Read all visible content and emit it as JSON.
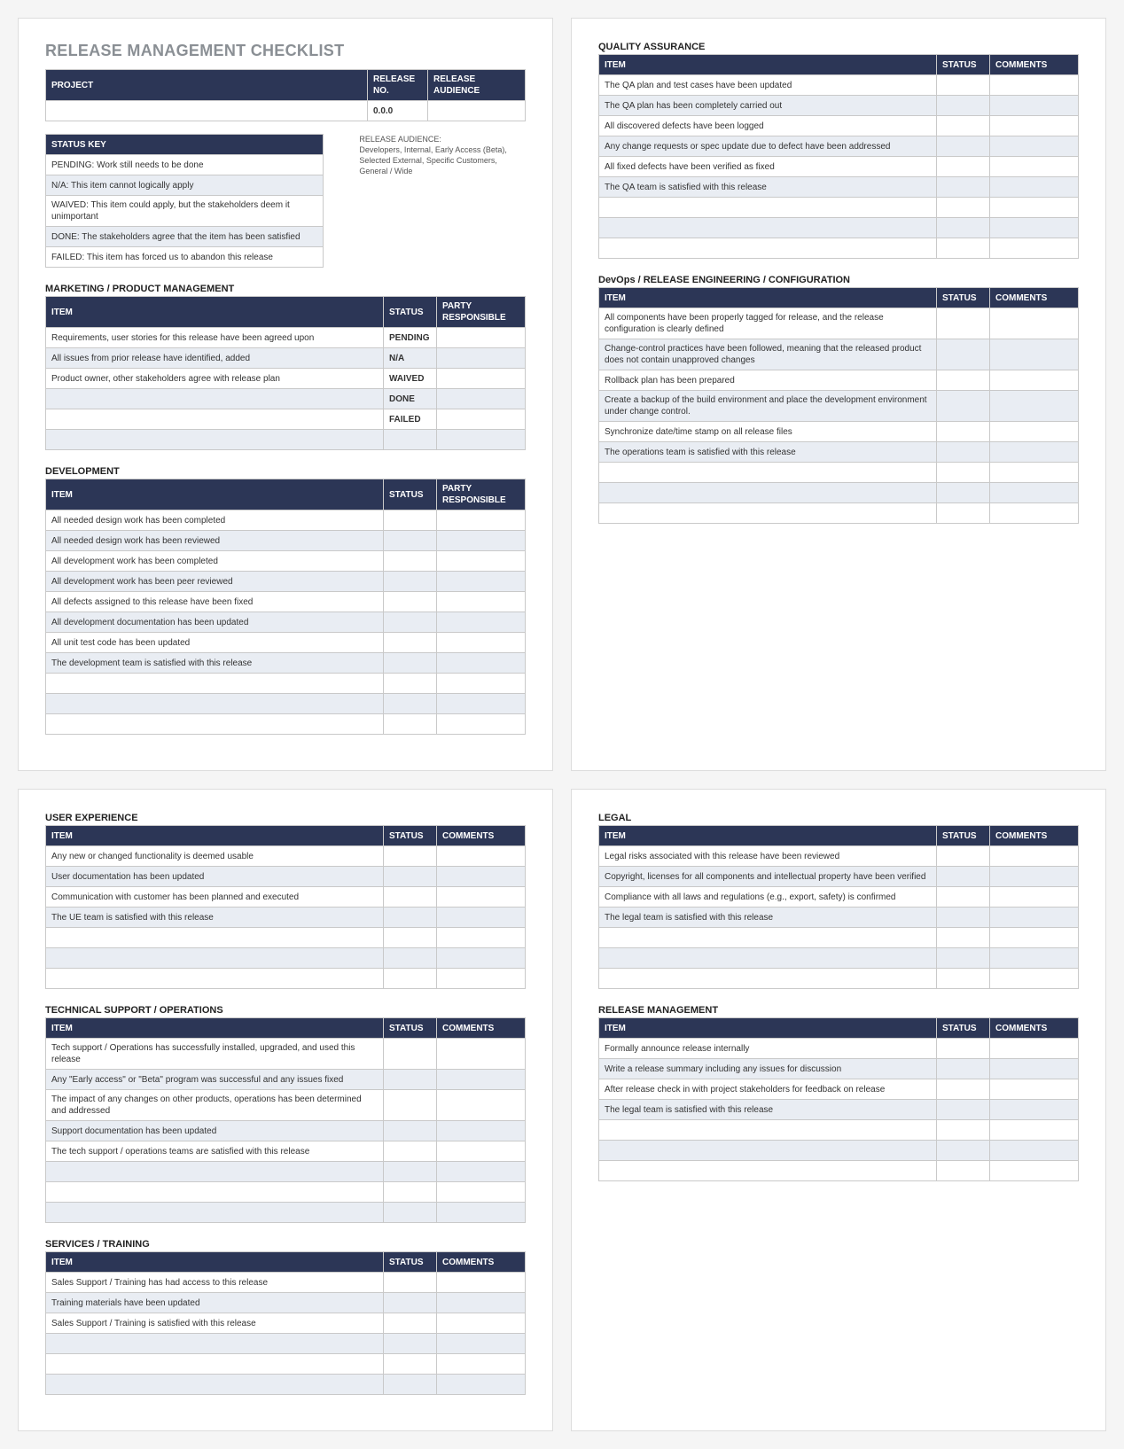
{
  "title": "RELEASE MANAGEMENT CHECKLIST",
  "proj_header": {
    "project": "PROJECT",
    "release_no": "RELEASE NO.",
    "release_aud": "RELEASE AUDIENCE",
    "release_no_val": "0.0.0"
  },
  "status_key": {
    "header": "STATUS KEY",
    "rows": [
      "PENDING:  Work still needs to be done",
      "N/A:  This item cannot logically apply",
      "WAIVED:  This item could apply, but the stakeholders deem it unimportant",
      "DONE:  The stakeholders agree that the item has been satisfied",
      "FAILED:  This item has forced us to abandon this release"
    ]
  },
  "audience_note": {
    "label": "RELEASE AUDIENCE:",
    "text": "Developers, Internal, Early Access (Beta), Selected External, Specific Customers, General / Wide"
  },
  "col": {
    "item": "ITEM",
    "status": "STATUS",
    "party": "PARTY RESPONSIBLE",
    "comments": "COMMENTS"
  },
  "sections": {
    "marketing": {
      "title": "MARKETING / PRODUCT MANAGEMENT",
      "third": "party",
      "rows": [
        {
          "item": "Requirements, user stories for this release have been agreed upon",
          "status": "PENDING"
        },
        {
          "item": "All issues from prior release have identified, added",
          "status": "N/A"
        },
        {
          "item": "Product owner, other stakeholders agree with release plan",
          "status": "WAIVED"
        },
        {
          "item": "",
          "status": "DONE"
        },
        {
          "item": "",
          "status": "FAILED"
        },
        {
          "item": "",
          "status": ""
        }
      ]
    },
    "development": {
      "title": "DEVELOPMENT",
      "third": "party",
      "rows": [
        {
          "item": "All needed design work has been completed"
        },
        {
          "item": "All needed design work has been reviewed"
        },
        {
          "item": "All development work has been completed"
        },
        {
          "item": "All development work has been peer reviewed"
        },
        {
          "item": "All defects assigned to this release have been fixed"
        },
        {
          "item": "All development documentation has been updated"
        },
        {
          "item": "All unit test code has been updated"
        },
        {
          "item": "The development team is satisfied with this release"
        },
        {
          "item": ""
        },
        {
          "item": ""
        },
        {
          "item": ""
        }
      ]
    },
    "qa": {
      "title": "QUALITY ASSURANCE",
      "third": "comments",
      "rows": [
        {
          "item": "The QA plan and test cases have been updated"
        },
        {
          "item": "The QA plan has been completely carried out"
        },
        {
          "item": "All discovered defects have been logged"
        },
        {
          "item": "Any change requests or spec update due to defect have been addressed"
        },
        {
          "item": "All fixed defects have been verified as fixed"
        },
        {
          "item": "The QA team is satisfied with this release"
        },
        {
          "item": ""
        },
        {
          "item": ""
        },
        {
          "item": ""
        }
      ]
    },
    "devops": {
      "title": "DevOps / RELEASE ENGINEERING / CONFIGURATION",
      "third": "comments",
      "rows": [
        {
          "item": "All components have been properly tagged for release, and the release configuration is clearly defined"
        },
        {
          "item": "Change-control practices have been followed, meaning that the released product does not contain unapproved changes"
        },
        {
          "item": "Rollback plan has been prepared"
        },
        {
          "item": "Create a backup of the build environment and place the development environment under change control."
        },
        {
          "item": "Synchronize date/time stamp on all release files"
        },
        {
          "item": "The operations team is satisfied with this release"
        },
        {
          "item": ""
        },
        {
          "item": ""
        },
        {
          "item": ""
        }
      ]
    },
    "ux": {
      "title": "USER EXPERIENCE",
      "third": "comments",
      "rows": [
        {
          "item": "Any new or changed functionality is deemed usable"
        },
        {
          "item": "User documentation has been updated"
        },
        {
          "item": "Communication with customer has been planned and executed"
        },
        {
          "item": "The UE team is satisfied with this release"
        },
        {
          "item": ""
        },
        {
          "item": ""
        },
        {
          "item": ""
        }
      ]
    },
    "tech": {
      "title": "TECHNICAL SUPPORT / OPERATIONS",
      "third": "comments",
      "rows": [
        {
          "item": "Tech support / Operations has successfully installed, upgraded, and used this release"
        },
        {
          "item": "Any \"Early access\" or \"Beta\" program was successful and any issues fixed"
        },
        {
          "item": "The impact of any changes on other products, operations has been determined and addressed"
        },
        {
          "item": "Support documentation has been updated"
        },
        {
          "item": "The tech support / operations teams are satisfied with this release"
        },
        {
          "item": ""
        },
        {
          "item": ""
        },
        {
          "item": ""
        }
      ]
    },
    "services": {
      "title": "SERVICES / TRAINING",
      "third": "comments",
      "rows": [
        {
          "item": "Sales Support / Training has had access to this release"
        },
        {
          "item": "Training materials have been updated"
        },
        {
          "item": "Sales Support / Training is satisfied with this release"
        },
        {
          "item": ""
        },
        {
          "item": ""
        },
        {
          "item": ""
        }
      ]
    },
    "legal": {
      "title": "LEGAL",
      "third": "comments",
      "rows": [
        {
          "item": "Legal risks associated with this release have been reviewed"
        },
        {
          "item": "Copyright, licenses for all components and intellectual property have been verified"
        },
        {
          "item": "Compliance with all laws and regulations (e.g., export, safety) is confirmed"
        },
        {
          "item": "The legal team is satisfied with this release"
        },
        {
          "item": ""
        },
        {
          "item": ""
        },
        {
          "item": ""
        }
      ]
    },
    "release": {
      "title": "RELEASE MANAGEMENT",
      "third": "comments",
      "rows": [
        {
          "item": "Formally announce release internally"
        },
        {
          "item": "Write a release summary including any issues for discussion"
        },
        {
          "item": "After release check in with project stakeholders for feedback on release"
        },
        {
          "item": "The legal team is satisfied with this release"
        },
        {
          "item": ""
        },
        {
          "item": ""
        },
        {
          "item": ""
        }
      ]
    }
  }
}
